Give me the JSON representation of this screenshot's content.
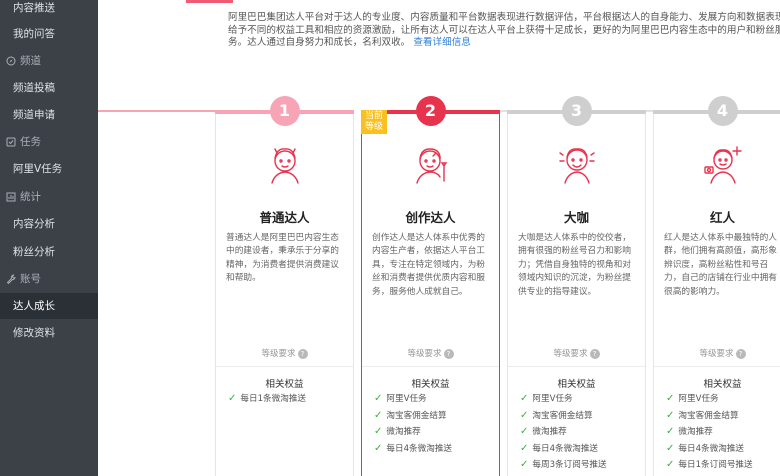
{
  "sidebar": {
    "items": [
      {
        "label": "内容推送"
      },
      {
        "label": "我的问答"
      },
      {
        "label": "频道"
      },
      {
        "label": "频道投稿"
      },
      {
        "label": "频道申请"
      },
      {
        "label": "任务"
      },
      {
        "label": "阿里V任务"
      },
      {
        "label": "统计"
      },
      {
        "label": "内容分析"
      },
      {
        "label": "粉丝分析"
      },
      {
        "label": "账号"
      },
      {
        "label": "达人成长"
      },
      {
        "label": "修改资料"
      }
    ]
  },
  "intro": {
    "text": "阿里巴巴集团达人平台对于达人的专业度、内容质量和平台数据表现进行数据评估，平台根据达人的自身能力、发展方向和数据表现给予不同的权益工具和相应的资源激励，让所有达人可以在达人平台上获得十足成长，更好的为阿里巴巴内容生态中的用户和粉丝服务。达人通过自身努力和成长，名利双收。",
    "link": "查看详细信息"
  },
  "colors": {
    "level1": "#f7a5b6",
    "level2": "#e8334e",
    "level3": "#cfcfcf",
    "level4": "#cfcfcf",
    "current_tag": "#f9c021",
    "check": "#3dad3f",
    "link": "#2f7fd8"
  },
  "cards": [
    {
      "number": "1",
      "title": "普通达人",
      "desc": "普通达人是阿里巴巴内容生态中的建设者，秉承乐于分享的精神，为消费者提供消费建议和帮助。",
      "req": "等级要求",
      "rights_title": "相关权益",
      "rights": [
        "每日1条微淘推送"
      ]
    },
    {
      "number": "2",
      "tag": "当前等级",
      "title": "创作达人",
      "desc": "创作达人是达人体系中优秀的内容生产者，依据达人平台工具，专注在特定领域内，为粉丝和消费者提供优质内容和服务，服务他人成就自己。",
      "req": "等级要求",
      "rights_title": "相关权益",
      "rights": [
        "阿里V任务",
        "淘宝客佣金结算",
        "微淘推荐",
        "每日4条微淘推送"
      ]
    },
    {
      "number": "3",
      "title": "大咖",
      "desc": "大咖是达人体系中的佼佼者，拥有很强的粉丝号召力和影响力；凭借自身独特的视角和对领域内知识的沉淀，为粉丝提供专业的指导建议。",
      "req": "等级要求",
      "rights_title": "相关权益",
      "rights": [
        "阿里V任务",
        "淘宝客佣金结算",
        "微淘推荐",
        "每日4条微淘推送",
        "每周3条订阅号推送"
      ]
    },
    {
      "number": "4",
      "title": "红人",
      "desc": "红人是达人体系中最独特的人群，他们拥有高颜值，高形象辨识度，高粉丝粘性和号召力，自己的店铺在行业中拥有很高的影响力。",
      "req": "等级要求",
      "rights_title": "相关权益",
      "rights": [
        "阿里V任务",
        "淘宝客佣金结算",
        "微淘推荐",
        "每日4条微淘推送",
        "每日1条订阅号推送"
      ]
    }
  ]
}
